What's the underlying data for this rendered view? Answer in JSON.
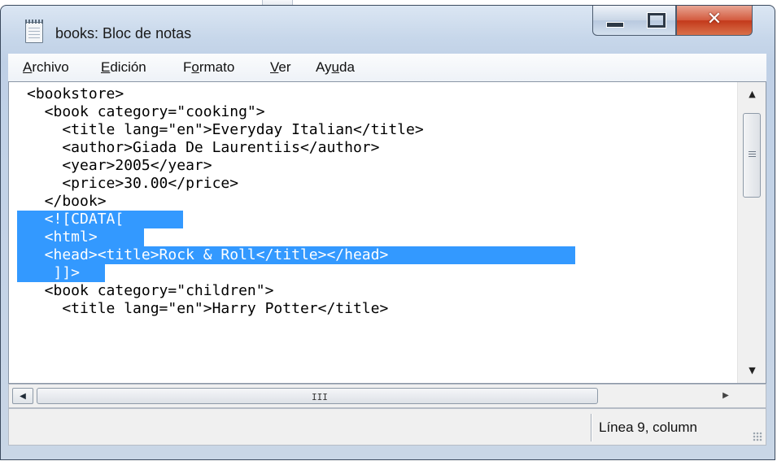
{
  "window": {
    "title": "books: Bloc de notas",
    "app_icon": "notepad-icon",
    "controls": {
      "minimize": "minimize-icon",
      "maximize": "maximize-icon",
      "close": "✕"
    }
  },
  "menu": [
    {
      "accel": "A",
      "rest": "rchivo",
      "pre": ""
    },
    {
      "accel": "E",
      "rest": "dición",
      "pre": ""
    },
    {
      "pre": "F",
      "accel": "o",
      "rest": "rmato"
    },
    {
      "accel": "V",
      "rest": "er",
      "pre": ""
    },
    {
      "pre": "Ay",
      "accel": "u",
      "rest": "da"
    }
  ],
  "editor": {
    "lines": [
      {
        "plain": "<bookstore>",
        "selected": ""
      },
      {
        "plain": "  <book category=\"cooking\">",
        "selected": ""
      },
      {
        "plain": "    <title lang=\"en\">Everyday Italian</title>",
        "selected": ""
      },
      {
        "plain": "    <author>Giada De Laurentiis</author>",
        "selected": ""
      },
      {
        "plain": "    <year>2005</year>",
        "selected": ""
      },
      {
        "plain": "    <price>30.00</price>",
        "selected": ""
      },
      {
        "plain": "  </book>",
        "selected": ""
      },
      {
        "plain": "",
        "selected": "  <![CDATA["
      },
      {
        "plain": "",
        "selected": "  <html>"
      },
      {
        "plain": "",
        "selected": "  <head><title>Rock & Roll</title></head>"
      },
      {
        "plain": "",
        "selected": "   ]]>"
      },
      {
        "plain": "  <book category=\"children\">",
        "selected": ""
      },
      {
        "plain": "    <title lang=\"en\">Harry Potter</title>",
        "selected": ""
      }
    ]
  },
  "scrollbar": {
    "h_grip": "III"
  },
  "status": {
    "text": "Línea 9, column"
  },
  "colors": {
    "selection": "#3399ff",
    "close_button": "#c3391b"
  }
}
